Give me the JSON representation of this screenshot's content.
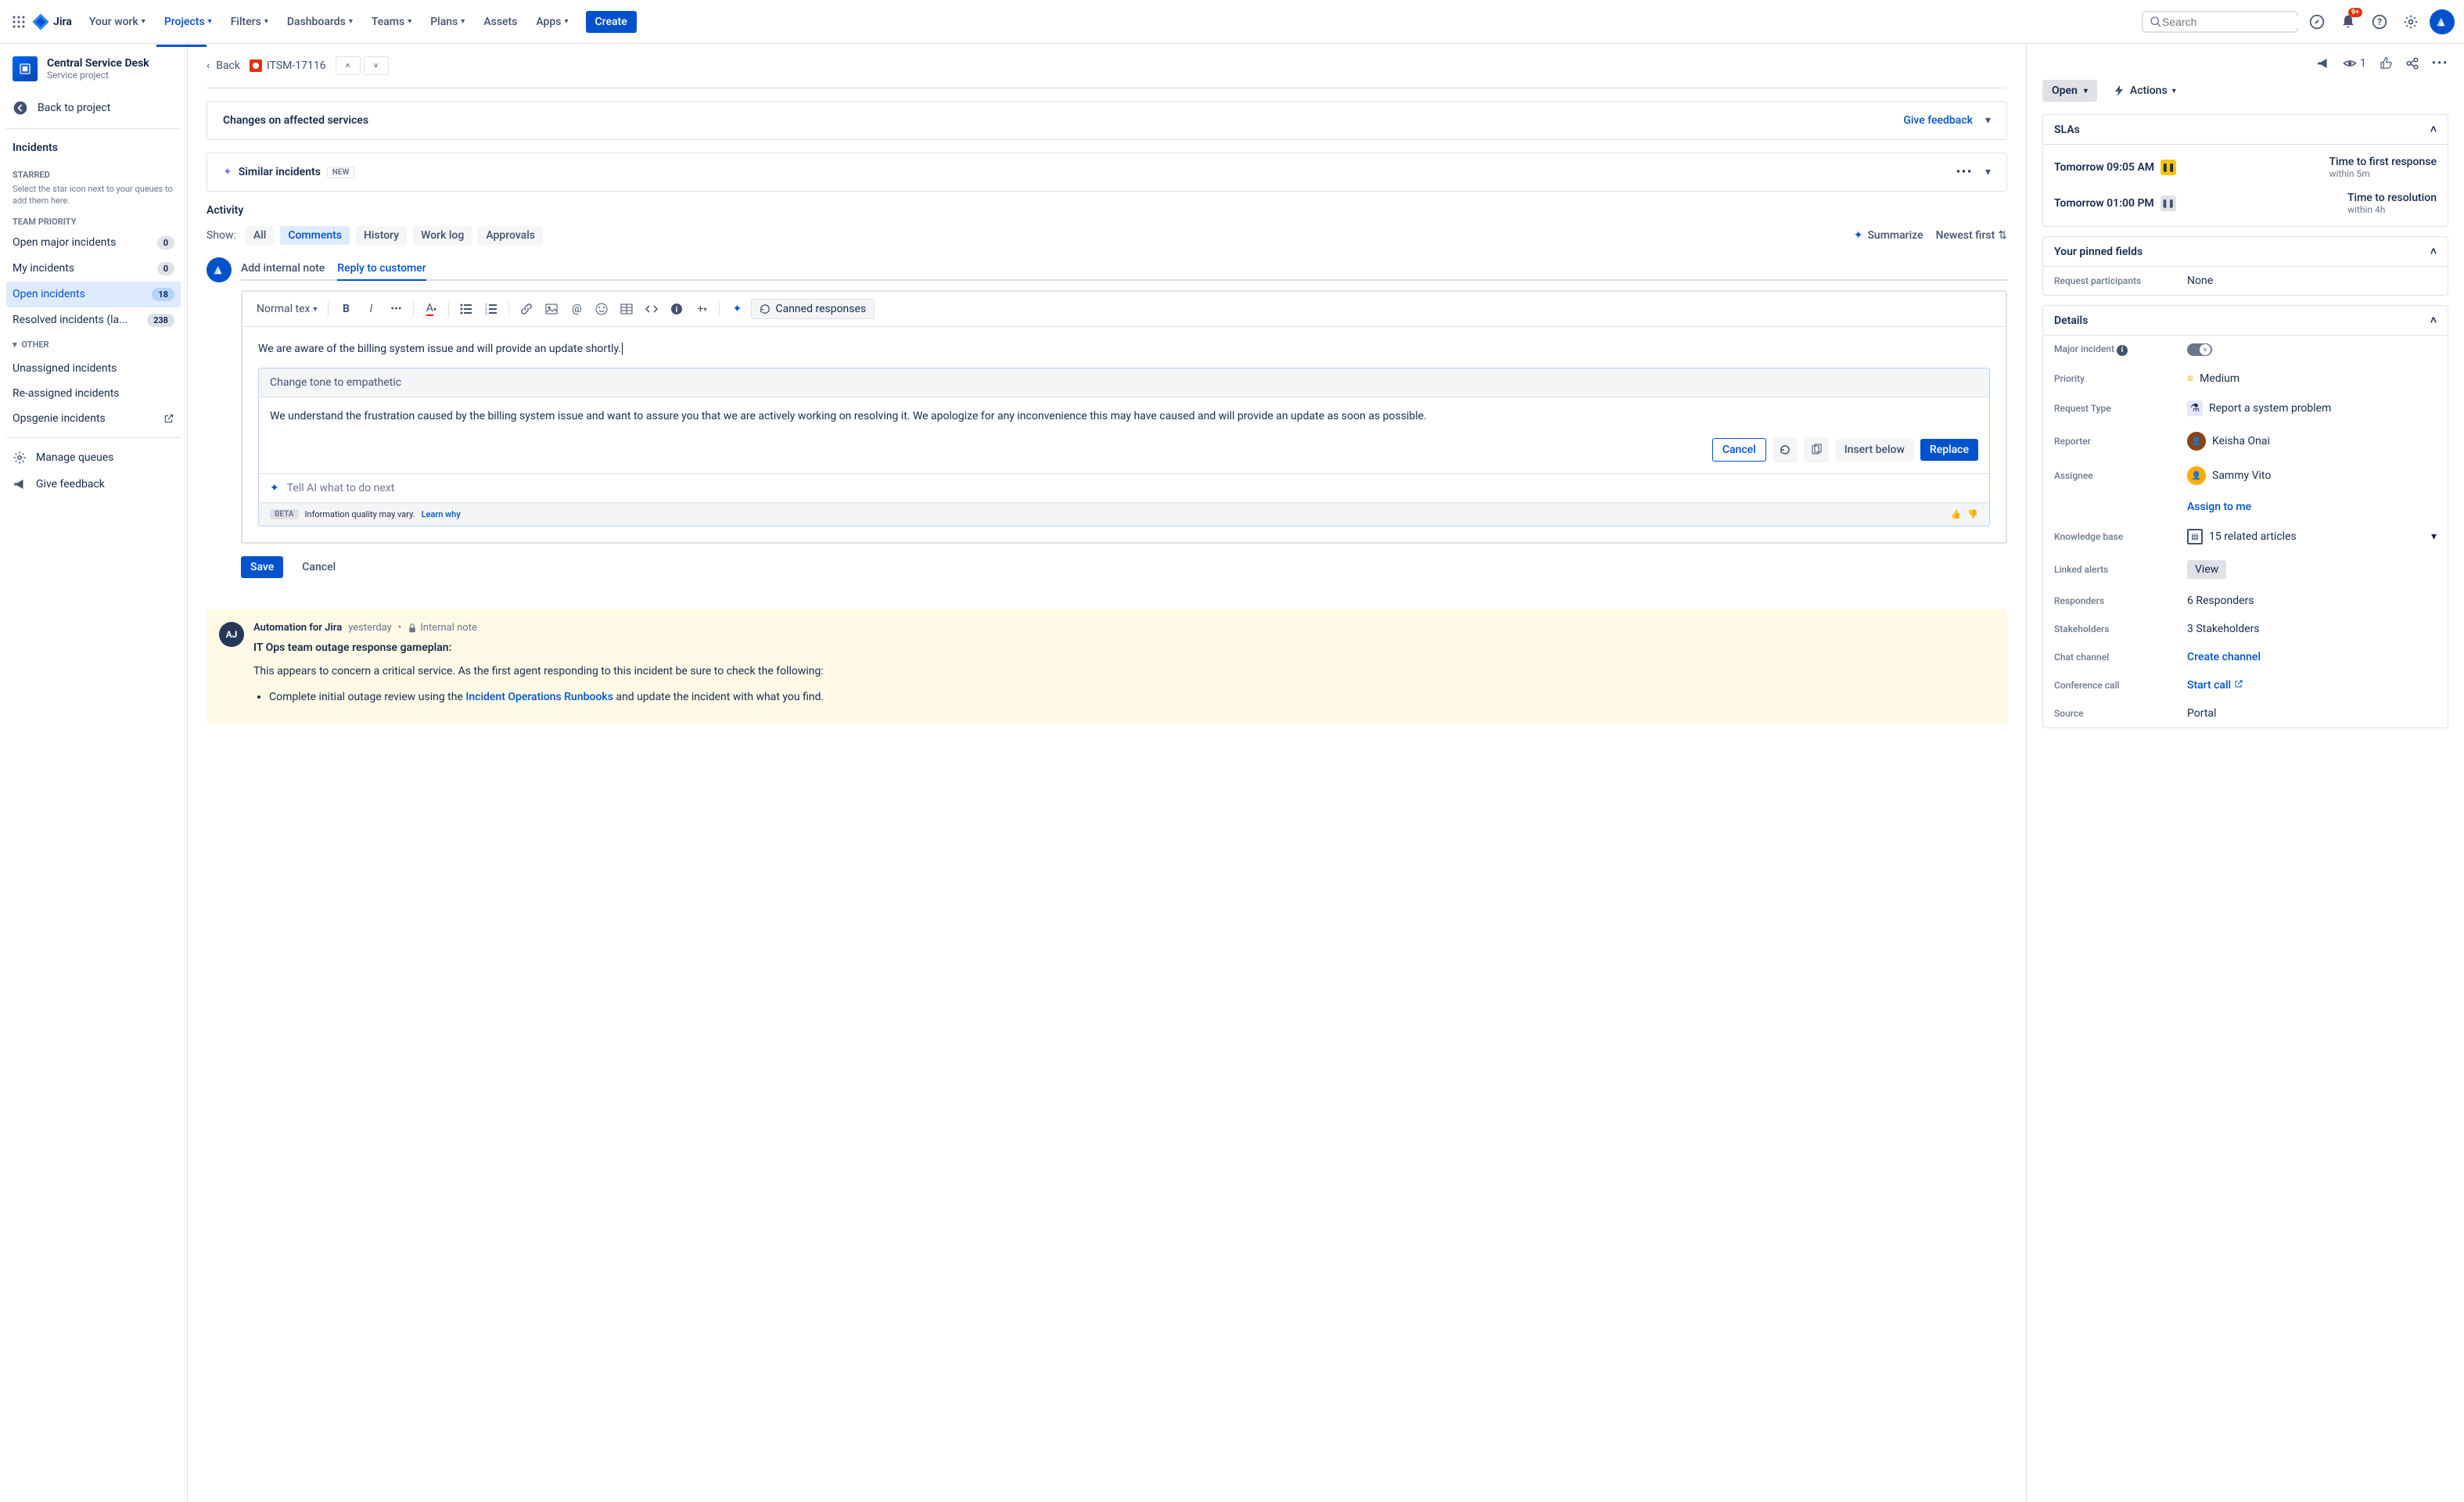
{
  "topbar": {
    "logo": "Jira",
    "nav": {
      "your_work": "Your work",
      "projects": "Projects",
      "filters": "Filters",
      "dashboards": "Dashboards",
      "teams": "Teams",
      "plans": "Plans",
      "assets": "Assets",
      "apps": "Apps"
    },
    "create": "Create",
    "search_placeholder": "Search",
    "notif_badge": "9+"
  },
  "sidebar": {
    "project_title": "Central Service Desk",
    "project_sub": "Service project",
    "back": "Back to project",
    "heading": "Incidents",
    "starred_label": "STARRED",
    "starred_hint": "Select the star icon next to your queues to add them here.",
    "team_priority_label": "TEAM PRIORITY",
    "queues": [
      {
        "label": "Open major incidents",
        "count": "0"
      },
      {
        "label": "My incidents",
        "count": "0"
      },
      {
        "label": "Open incidents",
        "count": "18"
      },
      {
        "label": "Resolved incidents (la...",
        "count": "238"
      }
    ],
    "other_label": "OTHER",
    "other_items": {
      "unassigned": "Unassigned incidents",
      "reassigned": "Re-assigned incidents",
      "opsgenie": "Opsgenie incidents"
    },
    "manage_queues": "Manage queues",
    "give_feedback": "Give feedback"
  },
  "breadcrumb": {
    "back": "Back",
    "issue_key": "ITSM-17116"
  },
  "panels": {
    "affected_title": "Changes on affected services",
    "affected_feedback": "Give feedback",
    "similar_title": "Similar incidents",
    "similar_tag": "NEW"
  },
  "activity": {
    "heading": "Activity",
    "show_label": "Show:",
    "filters": {
      "all": "All",
      "comments": "Comments",
      "history": "History",
      "worklog": "Work log",
      "approvals": "Approvals"
    },
    "summarize": "Summarize",
    "sort": "Newest first"
  },
  "reply": {
    "tab_note": "Add internal note",
    "tab_customer": "Reply to customer",
    "toolbar_text_style": "Normal tex",
    "canned": "Canned responses",
    "draft": "We are aware of the billing system issue and will provide an update shortly."
  },
  "ai": {
    "prompt": "Change tone to empathetic",
    "response": "We understand the frustration caused by the billing system issue and want to assure you that we are actively working on resolving it. We apologize for any inconvenience this may have caused and will provide an update as soon as possible.",
    "cancel": "Cancel",
    "insert_below": "Insert below",
    "replace": "Replace",
    "followup": "Tell AI what to do next",
    "beta": "BETA",
    "disclaimer": "Information quality may vary.",
    "learn": "Learn why"
  },
  "save_row": {
    "save": "Save",
    "cancel": "Cancel"
  },
  "comment": {
    "avatar": "AJ",
    "author": "Automation for Jira",
    "time": "yesterday",
    "tag": "Internal note",
    "title": "IT Ops team outage response gameplan:",
    "body": "This appears to concern a critical service. As the first agent responding to this incident be sure to check the following:",
    "bullet_pre": "Complete initial outage review using the ",
    "bullet_link": "Incident Operations Runbooks",
    "bullet_post": " and update the incident with what you find."
  },
  "right": {
    "watch_count": "1",
    "status": "Open",
    "actions": "Actions",
    "slas_heading": "SLAs",
    "slas": [
      {
        "time": "Tomorrow 09:05 AM",
        "warn": true,
        "title": "Time to first response",
        "sub": "within 5m"
      },
      {
        "time": "Tomorrow 01:00 PM",
        "warn": false,
        "title": "Time to resolution",
        "sub": "within 4h"
      }
    ],
    "pinned_heading": "Your pinned fields",
    "pinned": {
      "request_participants_label": "Request participants",
      "request_participants_value": "None"
    },
    "details_heading": "Details",
    "details": {
      "major_label": "Major incident",
      "priority_label": "Priority",
      "priority_value": "Medium",
      "request_type_label": "Request Type",
      "request_type_value": "Report a system problem",
      "reporter_label": "Reporter",
      "reporter_value": "Keisha Onai",
      "assignee_label": "Assignee",
      "assignee_value": "Sammy Vito",
      "assign_to_me": "Assign to me",
      "kb_label": "Knowledge base",
      "kb_value": "15 related articles",
      "linked_alerts_label": "Linked alerts",
      "linked_alerts_value": "View",
      "responders_label": "Responders",
      "responders_value": "6 Responders",
      "stakeholders_label": "Stakeholders",
      "stakeholders_value": "3 Stakeholders",
      "chat_label": "Chat channel",
      "chat_value": "Create channel",
      "conf_label": "Conference call",
      "conf_value": "Start call",
      "source_label": "Source",
      "source_value": "Portal"
    }
  }
}
